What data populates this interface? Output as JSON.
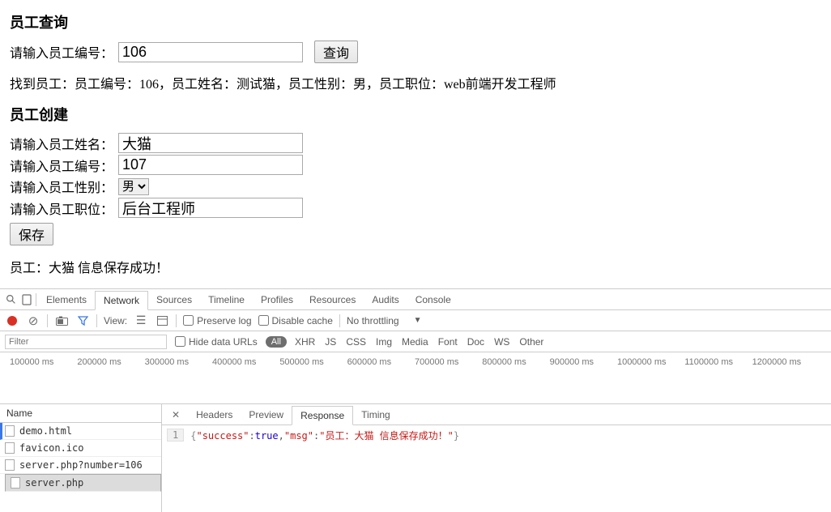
{
  "query": {
    "heading": "员工查询",
    "label": "请输入员工编号：",
    "value": "106",
    "button": "查询",
    "result": "找到员工：员工编号：106，员工姓名：测试猫，员工性别：男，员工职位：web前端开发工程师"
  },
  "create": {
    "heading": "员工创建",
    "name_label": "请输入员工姓名：",
    "name_value": "大猫",
    "id_label": "请输入员工编号：",
    "id_value": "107",
    "gender_label": "请输入员工性别：",
    "gender_value": "男",
    "position_label": "请输入员工职位：",
    "position_value": "后台工程师",
    "save_button": "保存",
    "save_result": "员工：大猫 信息保存成功！"
  },
  "devtools": {
    "tabs": [
      "Elements",
      "Network",
      "Sources",
      "Timeline",
      "Profiles",
      "Resources",
      "Audits",
      "Console"
    ],
    "active_tab": "Network",
    "toolbar": {
      "view_label": "View:",
      "preserve_log": "Preserve log",
      "disable_cache": "Disable cache",
      "throttling": "No throttling"
    },
    "filter": {
      "placeholder": "Filter",
      "hide_data_urls": "Hide data URLs",
      "all": "All",
      "types": [
        "XHR",
        "JS",
        "CSS",
        "Img",
        "Media",
        "Font",
        "Doc",
        "WS",
        "Other"
      ]
    },
    "timeline_ticks": [
      "100000 ms",
      "200000 ms",
      "300000 ms",
      "400000 ms",
      "500000 ms",
      "600000 ms",
      "700000 ms",
      "800000 ms",
      "900000 ms",
      "1000000 ms",
      "1100000 ms",
      "1200000 ms"
    ],
    "requests": {
      "header": "Name",
      "rows": [
        "demo.html",
        "favicon.ico",
        "server.php?number=106",
        "server.php"
      ],
      "selected_index": 3,
      "highlighted_index": 0
    },
    "detail": {
      "tabs": [
        "Headers",
        "Preview",
        "Response",
        "Timing"
      ],
      "active": "Response",
      "line_no": "1",
      "response_json": {
        "success": true,
        "msg": "员工：大猫 信息保存成功！"
      }
    }
  }
}
